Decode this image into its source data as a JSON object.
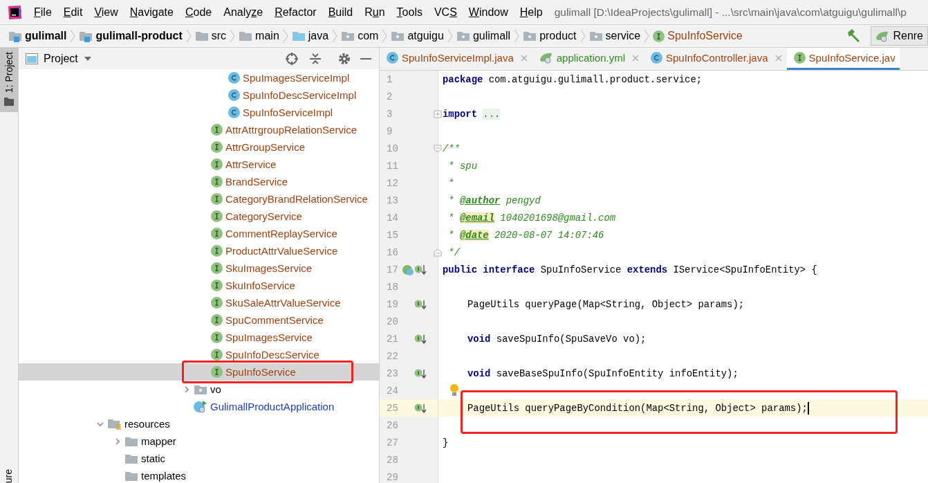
{
  "menu": [
    {
      "key": "F",
      "post": "ile"
    },
    {
      "key": "E",
      "post": "dit"
    },
    {
      "key": "V",
      "post": "iew"
    },
    {
      "key": "N",
      "post": "avigate"
    },
    {
      "key": "C",
      "post": "ode"
    },
    {
      "pre": "Analy",
      "key": "z",
      "post": "e"
    },
    {
      "key": "R",
      "post": "efactor"
    },
    {
      "key": "B",
      "post": "uild"
    },
    {
      "pre": "R",
      "key": "u",
      "post": "n"
    },
    {
      "key": "T",
      "post": "ools"
    },
    {
      "pre": "VC",
      "key": "S"
    },
    {
      "key": "W",
      "post": "indow"
    },
    {
      "key": "H",
      "post": "elp"
    }
  ],
  "window": {
    "title": "gulimall [D:\\IdeaProjects\\gulimall] - ...\\src\\main\\java\\com\\atguigu\\gulimall\\p"
  },
  "breadcrumbs": [
    {
      "label": "gulimall",
      "kind": "module"
    },
    {
      "label": "gulimall-product",
      "kind": "module"
    },
    {
      "label": "src",
      "kind": "folder"
    },
    {
      "label": "main",
      "kind": "folder"
    },
    {
      "label": "java",
      "kind": "source"
    },
    {
      "label": "com",
      "kind": "package"
    },
    {
      "label": "atguigu",
      "kind": "package"
    },
    {
      "label": "gulimall",
      "kind": "package"
    },
    {
      "label": "product",
      "kind": "package"
    },
    {
      "label": "service",
      "kind": "package"
    },
    {
      "label": "SpuInfoService",
      "kind": "interface"
    }
  ],
  "run_config": {
    "label": "Renre"
  },
  "side_strip": {
    "top_tab": "1: Project",
    "bottom_tab": "ure"
  },
  "project_panel": {
    "title": "Project"
  },
  "tree": [
    {
      "children": [
        {
          "children": [
            {
              "children": [
                {
                  "children": [
                    {
                      "children": [
                        {
                          "children": [
                            {
                              "children": [
                                {
                                  "label": "SpuImagesServiceImpl",
                                  "kind": "class",
                                  "selected": false
                                },
                                {
                                  "label": "SpuInfoDescServiceImpl",
                                  "kind": "class",
                                  "selected": false
                                },
                                {
                                  "label": "SpuInfoServiceImpl",
                                  "kind": "class",
                                  "selected": false
                                }
                              ]
                            },
                            {
                              "label": "AttrAttrgroupRelationService",
                              "kind": "interface",
                              "selected": false
                            },
                            {
                              "label": "AttrGroupService",
                              "kind": "interface",
                              "selected": false
                            },
                            {
                              "label": "AttrService",
                              "kind": "interface",
                              "selected": false
                            },
                            {
                              "label": "BrandService",
                              "kind": "interface",
                              "selected": false
                            },
                            {
                              "label": "CategoryBrandRelationService",
                              "kind": "interface",
                              "selected": false
                            },
                            {
                              "label": "CategoryService",
                              "kind": "interface",
                              "selected": false
                            },
                            {
                              "label": "CommentReplayService",
                              "kind": "interface",
                              "selected": false
                            },
                            {
                              "label": "ProductAttrValueService",
                              "kind": "interface",
                              "selected": false
                            },
                            {
                              "label": "SkuImagesService",
                              "kind": "interface",
                              "selected": false
                            },
                            {
                              "label": "SkuInfoService",
                              "kind": "interface",
                              "selected": false
                            },
                            {
                              "label": "SkuSaleAttrValueService",
                              "kind": "interface",
                              "selected": false
                            },
                            {
                              "label": "SpuCommentService",
                              "kind": "interface",
                              "selected": false
                            },
                            {
                              "label": "SpuImagesService",
                              "kind": "interface",
                              "selected": false
                            },
                            {
                              "label": "SpuInfoDescService",
                              "kind": "interface",
                              "selected": false
                            },
                            {
                              "label": "SpuInfoService",
                              "kind": "interface",
                              "selected": true,
                              "annotated": true
                            }
                          ]
                        },
                        {
                          "label": "vo",
                          "kind": "package",
                          "selected": false,
                          "expanded": false
                        },
                        {
                          "label": "GulimallProductApplication",
                          "kind": "app",
                          "selected": false
                        }
                      ]
                    }
                  ]
                }
              ]
            }
          ]
        }
      ]
    },
    {
      "label": "resources",
      "kind": "resources",
      "selected": false,
      "expanded": true,
      "children": [
        {
          "label": "mapper",
          "kind": "folder",
          "selected": false,
          "expanded": false
        },
        {
          "label": "static",
          "kind": "folder",
          "selected": false
        },
        {
          "label": "templates",
          "kind": "folder",
          "selected": false
        }
      ]
    }
  ],
  "tabs": [
    {
      "label": "SpuInfoServiceImpl.java",
      "kind": "class",
      "selected": false
    },
    {
      "label": "application.yml",
      "kind": "yaml",
      "selected": false
    },
    {
      "label": "SpuInfoController.java",
      "kind": "class",
      "selected": false
    },
    {
      "label": "SpuInfoService.jav",
      "kind": "interface",
      "selected": true
    }
  ],
  "code": [
    {
      "number": "1",
      "current": false,
      "segments": [
        {
          "text": "package",
          "kind": "kw"
        },
        {
          "text": " com.atguigu.gulimall.product.service;",
          "kind": "plain"
        }
      ]
    },
    {
      "number": "2",
      "current": false
    },
    {
      "number": "3",
      "current": false,
      "fold_marker": {
        "kind": "expand"
      },
      "segments": [
        {
          "text": "import",
          "kind": "kw"
        },
        {
          "text": "...",
          "kind": "folded"
        }
      ]
    },
    {
      "number": "9",
      "current": false
    },
    {
      "number": "10",
      "current": false,
      "fold_marker": {
        "kind": "collapse"
      },
      "segments": [
        {
          "text": "/**",
          "kind": "comment"
        }
      ]
    },
    {
      "number": "11",
      "current": false,
      "segments": [
        {
          "text": " * spu",
          "kind": "comment"
        }
      ]
    },
    {
      "number": "12",
      "current": false,
      "segments": [
        {
          "text": " *",
          "kind": "comment"
        }
      ]
    },
    {
      "number": "13",
      "current": false,
      "segments": [
        {
          "text": " * ",
          "kind": "comment"
        },
        {
          "text": "@author",
          "kind": "tag"
        },
        {
          "text": " pengyd",
          "kind": "comment"
        }
      ]
    },
    {
      "number": "14",
      "current": false,
      "segments": [
        {
          "text": " * ",
          "kind": "comment"
        },
        {
          "text": "@email",
          "kind": "tag_marked"
        },
        {
          "text": " 1040201698@gmail.com",
          "kind": "comment"
        }
      ]
    },
    {
      "number": "15",
      "current": false,
      "segments": [
        {
          "text": " * ",
          "kind": "comment"
        },
        {
          "text": "@date",
          "kind": "tag_marked"
        },
        {
          "text": " 2020-08-07 14:07:46",
          "kind": "comment"
        }
      ]
    },
    {
      "number": "16",
      "current": false,
      "fold_marker": {
        "kind": "end"
      },
      "segments": [
        {
          "text": " */",
          "kind": "comment"
        }
      ]
    },
    {
      "number": "17",
      "current": false,
      "gutter_icon": {
        "kind": "inherited"
      },
      "segments": [
        {
          "text": "public",
          "kind": "kw"
        },
        {
          "text": " interface",
          "kind": "kw"
        },
        {
          "text": " SpuInfoService ",
          "kind": "plain"
        },
        {
          "text": "extends",
          "kind": "kw"
        },
        {
          "text": " IService<SpuInfoEntity> {",
          "kind": "plain"
        }
      ]
    },
    {
      "number": "18",
      "current": false
    },
    {
      "number": "19",
      "current": false,
      "indent": true,
      "gutter_icon": {
        "kind": "implemented"
      },
      "segments": [
        {
          "text": "PageUtils queryPage(Map<String, Object> params);",
          "kind": "plain"
        }
      ]
    },
    {
      "number": "20",
      "current": false
    },
    {
      "number": "21",
      "current": false,
      "indent": true,
      "gutter_icon": {
        "kind": "implemented"
      },
      "segments": [
        {
          "text": "void",
          "kind": "kw"
        },
        {
          "text": " saveSpuInfo(SpuSaveVo vo);",
          "kind": "plain"
        }
      ]
    },
    {
      "number": "22",
      "current": false
    },
    {
      "number": "23",
      "current": false,
      "indent": true,
      "gutter_icon": {
        "kind": "implemented"
      },
      "segments": [
        {
          "text": "void",
          "kind": "kw"
        },
        {
          "text": " saveBaseSpuInfo(SpuInfoEntity infoEntity);",
          "kind": "plain"
        }
      ]
    },
    {
      "number": "24",
      "current": false,
      "bulb": true
    },
    {
      "number": "25",
      "current": true,
      "indent": true,
      "gutter_icon": {
        "kind": "implemented"
      },
      "caret": true,
      "annotated": true,
      "segments": [
        {
          "text": "PageUtils queryPageByCondition(Map<String, Object> params);",
          "kind": "plain"
        }
      ]
    },
    {
      "number": "26",
      "current": false
    },
    {
      "number": "27",
      "current": false,
      "segments": [
        {
          "text": "}",
          "kind": "plain"
        }
      ]
    },
    {
      "number": "28",
      "current": false
    },
    {
      "number": "29",
      "current": false
    }
  ]
}
